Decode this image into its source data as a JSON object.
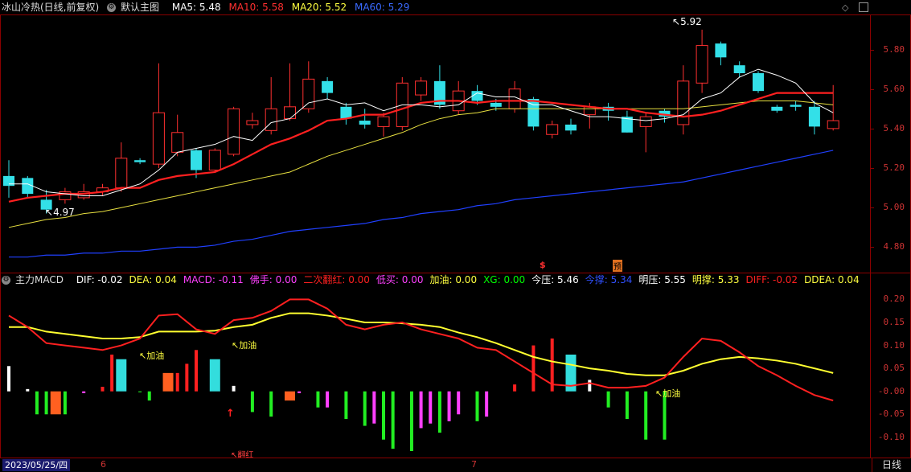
{
  "main_header": {
    "title": "冰山冷热(日线,前复权)",
    "template": "默认主图",
    "ma5": "MA5: 5.48",
    "ma10": "MA10: 5.58",
    "ma20": "MA20: 5.52",
    "ma60": "MA60: 5.29",
    "colors": {
      "ma5": "#ffffff",
      "ma10": "#ff2020",
      "ma20": "#ffff40",
      "ma60": "#3050ff"
    }
  },
  "sub_header": {
    "title": "主力MACD",
    "items": [
      {
        "text": "DIF: -0.02",
        "color": "#ffffff"
      },
      {
        "text": "DEA: 0.04",
        "color": "#ffff40"
      },
      {
        "text": "MACD: -0.11",
        "color": "#ff40ff"
      },
      {
        "text": "佛手: 0.00",
        "color": "#ff40ff"
      },
      {
        "text": "二次翻红: 0.00",
        "color": "#ff2020"
      },
      {
        "text": "低买: 0.00",
        "color": "#ff40ff"
      },
      {
        "text": "加油: 0.00",
        "color": "#ffff40"
      },
      {
        "text": "XG: 0.00",
        "color": "#00ff00"
      },
      {
        "text": "今压: 5.46",
        "color": "#ffffff"
      },
      {
        "text": "今撑: 5.34",
        "color": "#3050ff"
      },
      {
        "text": "明压: 5.55",
        "color": "#ffffff"
      },
      {
        "text": "明撑: 5.33",
        "color": "#ffff40"
      },
      {
        "text": "DIFF: -0.02",
        "color": "#ff2020"
      },
      {
        "text": "DDEA: 0.04",
        "color": "#ffff40"
      }
    ]
  },
  "price_axis_labels": [
    "5.80",
    "5.60",
    "5.40",
    "5.20",
    "5.00",
    "4.80"
  ],
  "macd_axis_labels": [
    "0.20",
    "0.15",
    "0.10",
    "0.05",
    "-0.00",
    "-0.05",
    "-0.10"
  ],
  "annotations": {
    "high": "5.92",
    "low": "4.97",
    "jiayou": "加油",
    "fanhong": "翻红",
    "marker_s": "$",
    "marker_yu": "预"
  },
  "bottom": {
    "date": "2023/05/25/四",
    "tick6": "6",
    "tick7": "7",
    "timeframe": "日线"
  },
  "chart_data": [
    {
      "type": "candlestick",
      "ylim": [
        4.7,
        5.92
      ],
      "candles": [
        {
          "o": 5.16,
          "c": 5.11,
          "h": 5.24,
          "l": 5.05,
          "up": false
        },
        {
          "o": 5.15,
          "c": 5.07,
          "h": 5.16,
          "l": 5.05,
          "up": false
        },
        {
          "o": 5.04,
          "c": 4.99,
          "h": 5.09,
          "l": 4.97,
          "up": false
        },
        {
          "o": 5.04,
          "c": 5.08,
          "h": 5.1,
          "l": 5.02,
          "up": true
        },
        {
          "o": 5.05,
          "c": 5.08,
          "h": 5.12,
          "l": 5.04,
          "up": true
        },
        {
          "o": 5.08,
          "c": 5.1,
          "h": 5.12,
          "l": 5.06,
          "up": true
        },
        {
          "o": 5.1,
          "c": 5.25,
          "h": 5.33,
          "l": 5.08,
          "up": true
        },
        {
          "o": 5.24,
          "c": 5.23,
          "h": 5.25,
          "l": 5.22,
          "up": false
        },
        {
          "o": 5.22,
          "c": 5.48,
          "h": 5.73,
          "l": 5.2,
          "up": true
        },
        {
          "o": 5.28,
          "c": 5.38,
          "h": 5.47,
          "l": 5.26,
          "up": true
        },
        {
          "o": 5.29,
          "c": 5.19,
          "h": 5.3,
          "l": 5.15,
          "up": false
        },
        {
          "o": 5.19,
          "c": 5.29,
          "h": 5.3,
          "l": 5.18,
          "up": true
        },
        {
          "o": 5.27,
          "c": 5.5,
          "h": 5.51,
          "l": 5.26,
          "up": true
        },
        {
          "o": 5.42,
          "c": 5.44,
          "h": 5.48,
          "l": 5.4,
          "up": true
        },
        {
          "o": 5.39,
          "c": 5.5,
          "h": 5.66,
          "l": 5.37,
          "up": true
        },
        {
          "o": 5.45,
          "c": 5.51,
          "h": 5.73,
          "l": 5.44,
          "up": true
        },
        {
          "o": 5.5,
          "c": 5.65,
          "h": 5.74,
          "l": 5.48,
          "up": true
        },
        {
          "o": 5.64,
          "c": 5.58,
          "h": 5.66,
          "l": 5.55,
          "up": false
        },
        {
          "o": 5.51,
          "c": 5.45,
          "h": 5.53,
          "l": 5.42,
          "up": false
        },
        {
          "o": 5.44,
          "c": 5.42,
          "h": 5.5,
          "l": 5.4,
          "up": false
        },
        {
          "o": 5.41,
          "c": 5.46,
          "h": 5.48,
          "l": 5.36,
          "up": true
        },
        {
          "o": 5.41,
          "c": 5.63,
          "h": 5.66,
          "l": 5.39,
          "up": true
        },
        {
          "o": 5.57,
          "c": 5.64,
          "h": 5.66,
          "l": 5.54,
          "up": true
        },
        {
          "o": 5.64,
          "c": 5.52,
          "h": 5.72,
          "l": 5.5,
          "up": false
        },
        {
          "o": 5.49,
          "c": 5.59,
          "h": 5.64,
          "l": 5.47,
          "up": true
        },
        {
          "o": 5.59,
          "c": 5.54,
          "h": 5.62,
          "l": 5.52,
          "up": false
        },
        {
          "o": 5.53,
          "c": 5.51,
          "h": 5.55,
          "l": 5.49,
          "up": false
        },
        {
          "o": 5.5,
          "c": 5.6,
          "h": 5.64,
          "l": 5.48,
          "up": true
        },
        {
          "o": 5.55,
          "c": 5.41,
          "h": 5.56,
          "l": 5.39,
          "up": false
        },
        {
          "o": 5.37,
          "c": 5.42,
          "h": 5.44,
          "l": 5.35,
          "up": true
        },
        {
          "o": 5.42,
          "c": 5.39,
          "h": 5.45,
          "l": 5.37,
          "up": false
        },
        {
          "o": 5.47,
          "c": 5.51,
          "h": 5.53,
          "l": 5.4,
          "up": true
        },
        {
          "o": 5.51,
          "c": 5.49,
          "h": 5.53,
          "l": 5.44,
          "up": false
        },
        {
          "o": 5.46,
          "c": 5.38,
          "h": 5.49,
          "l": 5.38,
          "up": false
        },
        {
          "o": 5.41,
          "c": 5.46,
          "h": 5.48,
          "l": 5.28,
          "up": true
        },
        {
          "o": 5.49,
          "c": 5.46,
          "h": 5.5,
          "l": 5.43,
          "up": false
        },
        {
          "o": 5.42,
          "c": 5.64,
          "h": 5.72,
          "l": 5.37,
          "up": true
        },
        {
          "o": 5.63,
          "c": 5.82,
          "h": 5.9,
          "l": 5.58,
          "up": true
        },
        {
          "o": 5.83,
          "c": 5.76,
          "h": 5.84,
          "l": 5.72,
          "up": false
        },
        {
          "o": 5.72,
          "c": 5.68,
          "h": 5.74,
          "l": 5.66,
          "up": false
        },
        {
          "o": 5.68,
          "c": 5.59,
          "h": 5.69,
          "l": 5.58,
          "up": false
        },
        {
          "o": 5.51,
          "c": 5.49,
          "h": 5.52,
          "l": 5.48,
          "up": false
        },
        {
          "o": 5.52,
          "c": 5.51,
          "h": 5.54,
          "l": 5.49,
          "up": false
        },
        {
          "o": 5.51,
          "c": 5.41,
          "h": 5.54,
          "l": 5.37,
          "up": false
        },
        {
          "o": 5.4,
          "c": 5.44,
          "h": 5.62,
          "l": 5.39,
          "up": true
        }
      ],
      "ma5": [
        5.12,
        5.12,
        5.08,
        5.07,
        5.06,
        5.06,
        5.09,
        5.12,
        5.19,
        5.28,
        5.3,
        5.32,
        5.36,
        5.34,
        5.43,
        5.45,
        5.53,
        5.55,
        5.52,
        5.53,
        5.49,
        5.52,
        5.52,
        5.51,
        5.52,
        5.58,
        5.56,
        5.56,
        5.52,
        5.52,
        5.49,
        5.46,
        5.46,
        5.45,
        5.44,
        5.45,
        5.47,
        5.55,
        5.58,
        5.66,
        5.7,
        5.67,
        5.63,
        5.53,
        5.48
      ],
      "ma10": [
        5.03,
        5.05,
        5.06,
        5.07,
        5.07,
        5.08,
        5.1,
        5.1,
        5.14,
        5.16,
        5.17,
        5.18,
        5.22,
        5.27,
        5.32,
        5.35,
        5.39,
        5.44,
        5.45,
        5.47,
        5.47,
        5.5,
        5.53,
        5.54,
        5.54,
        5.53,
        5.54,
        5.54,
        5.54,
        5.53,
        5.52,
        5.51,
        5.5,
        5.5,
        5.48,
        5.47,
        5.46,
        5.47,
        5.49,
        5.52,
        5.55,
        5.58,
        5.58,
        5.58,
        5.58
      ],
      "ma20": [
        4.9,
        4.92,
        4.94,
        4.95,
        4.97,
        4.98,
        5.0,
        5.02,
        5.04,
        5.06,
        5.08,
        5.1,
        5.12,
        5.14,
        5.16,
        5.18,
        5.22,
        5.26,
        5.29,
        5.32,
        5.35,
        5.38,
        5.42,
        5.45,
        5.47,
        5.48,
        5.5,
        5.5,
        5.5,
        5.5,
        5.5,
        5.5,
        5.5,
        5.5,
        5.5,
        5.5,
        5.5,
        5.51,
        5.52,
        5.53,
        5.54,
        5.54,
        5.54,
        5.53,
        5.52
      ],
      "ma60": [
        4.75,
        4.75,
        4.76,
        4.76,
        4.77,
        4.77,
        4.78,
        4.78,
        4.79,
        4.8,
        4.8,
        4.81,
        4.83,
        4.84,
        4.86,
        4.88,
        4.89,
        4.9,
        4.91,
        4.92,
        4.94,
        4.95,
        4.97,
        4.98,
        4.99,
        5.01,
        5.02,
        5.04,
        5.05,
        5.06,
        5.07,
        5.08,
        5.09,
        5.1,
        5.11,
        5.12,
        5.13,
        5.15,
        5.17,
        5.19,
        5.21,
        5.23,
        5.25,
        5.27,
        5.29
      ]
    },
    {
      "type": "bar",
      "ylim": [
        -0.13,
        0.22
      ],
      "macd_bars": [
        {
          "v": 0.055,
          "c": "#ffffff"
        },
        {
          "v": 0.0,
          "c": "#000"
        },
        {
          "v": 0.005,
          "c": "#ffffff"
        },
        {
          "v": -0.05,
          "c": "#22ee22"
        },
        {
          "v": -0.05,
          "c": "#22ee22"
        },
        {
          "v": -0.05,
          "c": "#ff6020"
        },
        {
          "v": -0.05,
          "c": "#22ee22"
        },
        {
          "v": 0.0,
          "c": "#000"
        },
        {
          "v": -0.004,
          "c": "#ff40ff"
        },
        {
          "v": 0.0,
          "c": "#000"
        },
        {
          "v": 0.01,
          "c": "#ff2020"
        },
        {
          "v": 0.08,
          "c": "#ff2020"
        },
        {
          "v": 0.07,
          "c": "#33dddd"
        },
        {
          "v": 0.0,
          "c": "#000"
        },
        {
          "v": -0.002,
          "c": "#22ee22"
        },
        {
          "v": -0.02,
          "c": "#22ee22"
        },
        {
          "v": 0.0,
          "c": "#000"
        },
        {
          "v": 0.04,
          "c": "#ff6020"
        },
        {
          "v": 0.04,
          "c": "#ff2020"
        },
        {
          "v": 0.06,
          "c": "#ff2020"
        },
        {
          "v": 0.09,
          "c": "#ff2020"
        },
        {
          "v": 0.0,
          "c": "#000"
        },
        {
          "v": 0.07,
          "c": "#33dddd"
        },
        {
          "v": 0.0,
          "c": "#000"
        },
        {
          "v": 0.012,
          "c": "#ffffff"
        },
        {
          "v": 0.0,
          "c": "#000"
        },
        {
          "v": -0.045,
          "c": "#22ee22"
        },
        {
          "v": 0.0,
          "c": "#000"
        },
        {
          "v": -0.055,
          "c": "#22ee22"
        },
        {
          "v": 0.0,
          "c": "#000"
        },
        {
          "v": -0.02,
          "c": "#ff6020"
        },
        {
          "v": -0.004,
          "c": "#ff40ff"
        },
        {
          "v": 0.0,
          "c": "#000"
        },
        {
          "v": -0.035,
          "c": "#22ee22"
        },
        {
          "v": -0.035,
          "c": "#ff40ff"
        },
        {
          "v": 0.0,
          "c": "#000"
        },
        {
          "v": -0.06,
          "c": "#22ee22"
        },
        {
          "v": 0.0,
          "c": "#000"
        },
        {
          "v": -0.075,
          "c": "#22ee22"
        },
        {
          "v": -0.07,
          "c": "#ff40ff"
        },
        {
          "v": -0.105,
          "c": "#22ee22"
        },
        {
          "v": -0.125,
          "c": "#22ee22"
        },
        {
          "v": 0.0,
          "c": "#000"
        },
        {
          "v": -0.13,
          "c": "#22ee22"
        },
        {
          "v": -0.08,
          "c": "#ff40ff"
        },
        {
          "v": -0.07,
          "c": "#ff40ff"
        },
        {
          "v": -0.09,
          "c": "#22ee22"
        },
        {
          "v": -0.065,
          "c": "#ff40ff"
        },
        {
          "v": -0.05,
          "c": "#ff40ff"
        },
        {
          "v": 0.0,
          "c": "#000"
        },
        {
          "v": -0.065,
          "c": "#22ee22"
        },
        {
          "v": -0.055,
          "c": "#ff40ff"
        },
        {
          "v": 0.0,
          "c": "#000"
        },
        {
          "v": 0.0,
          "c": "#000"
        },
        {
          "v": 0.015,
          "c": "#ff2020"
        },
        {
          "v": 0.0,
          "c": "#000"
        },
        {
          "v": 0.1,
          "c": "#ff2020"
        },
        {
          "v": 0.0,
          "c": "#000"
        },
        {
          "v": 0.115,
          "c": "#ff2020"
        },
        {
          "v": 0.0,
          "c": "#000"
        },
        {
          "v": 0.08,
          "c": "#33dddd"
        },
        {
          "v": 0.0,
          "c": "#000"
        },
        {
          "v": 0.025,
          "c": "#ffffff"
        },
        {
          "v": 0.0,
          "c": "#000"
        },
        {
          "v": -0.035,
          "c": "#22ee22"
        },
        {
          "v": 0.0,
          "c": "#000"
        },
        {
          "v": -0.06,
          "c": "#22ee22"
        },
        {
          "v": 0.0,
          "c": "#000"
        },
        {
          "v": -0.105,
          "c": "#22ee22"
        },
        {
          "v": 0.0,
          "c": "#000"
        },
        {
          "v": -0.105,
          "c": "#22ee22"
        }
      ],
      "dif": [
        0.165,
        0.14,
        0.105,
        0.1,
        0.095,
        0.09,
        0.1,
        0.115,
        0.165,
        0.168,
        0.135,
        0.125,
        0.155,
        0.16,
        0.175,
        0.2,
        0.2,
        0.18,
        0.145,
        0.135,
        0.145,
        0.15,
        0.135,
        0.125,
        0.115,
        0.095,
        0.09,
        0.065,
        0.04,
        0.015,
        0.012,
        0.018,
        0.008,
        0.008,
        0.012,
        0.03,
        0.075,
        0.115,
        0.11,
        0.085,
        0.055,
        0.035,
        0.012,
        -0.008,
        -0.02
      ],
      "dea": [
        0.14,
        0.14,
        0.13,
        0.125,
        0.12,
        0.115,
        0.115,
        0.118,
        0.13,
        0.13,
        0.13,
        0.132,
        0.14,
        0.145,
        0.16,
        0.17,
        0.17,
        0.165,
        0.158,
        0.15,
        0.15,
        0.148,
        0.145,
        0.14,
        0.128,
        0.118,
        0.105,
        0.09,
        0.075,
        0.065,
        0.058,
        0.05,
        0.045,
        0.038,
        0.035,
        0.035,
        0.045,
        0.06,
        0.07,
        0.075,
        0.072,
        0.067,
        0.06,
        0.05,
        0.04
      ]
    }
  ]
}
